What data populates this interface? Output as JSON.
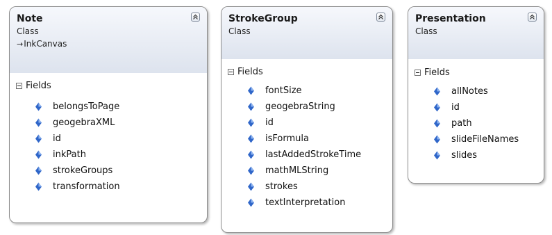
{
  "classes": [
    {
      "name": "Note",
      "stereotype": "Class",
      "inherits": "InkCanvas",
      "section_label": "Fields",
      "fields": [
        "belongsToPage",
        "geogebraXML",
        "id",
        "inkPath",
        "strokeGroups",
        "transformation"
      ]
    },
    {
      "name": "StrokeGroup",
      "stereotype": "Class",
      "section_label": "Fields",
      "fields": [
        "fontSize",
        "geogebraString",
        "id",
        "isFormula",
        "lastAddedStrokeTime",
        "mathMLString",
        "strokes",
        "textInterpretation"
      ]
    },
    {
      "name": "Presentation",
      "stereotype": "Class",
      "section_label": "Fields",
      "fields": [
        "allNotes",
        "id",
        "path",
        "slideFileNames",
        "slides"
      ]
    }
  ],
  "icons": {
    "field": "field-diamond-icon",
    "collapse": "double-chevron-up-icon",
    "section_toggle": "minus-box-icon",
    "inherit": "inheritance-arrow-icon"
  },
  "colors": {
    "field_icon_blue": "#2f66c9",
    "header_top": "#f6f8fc",
    "header_bottom": "#dde3ee",
    "border": "#8d8d8d"
  }
}
